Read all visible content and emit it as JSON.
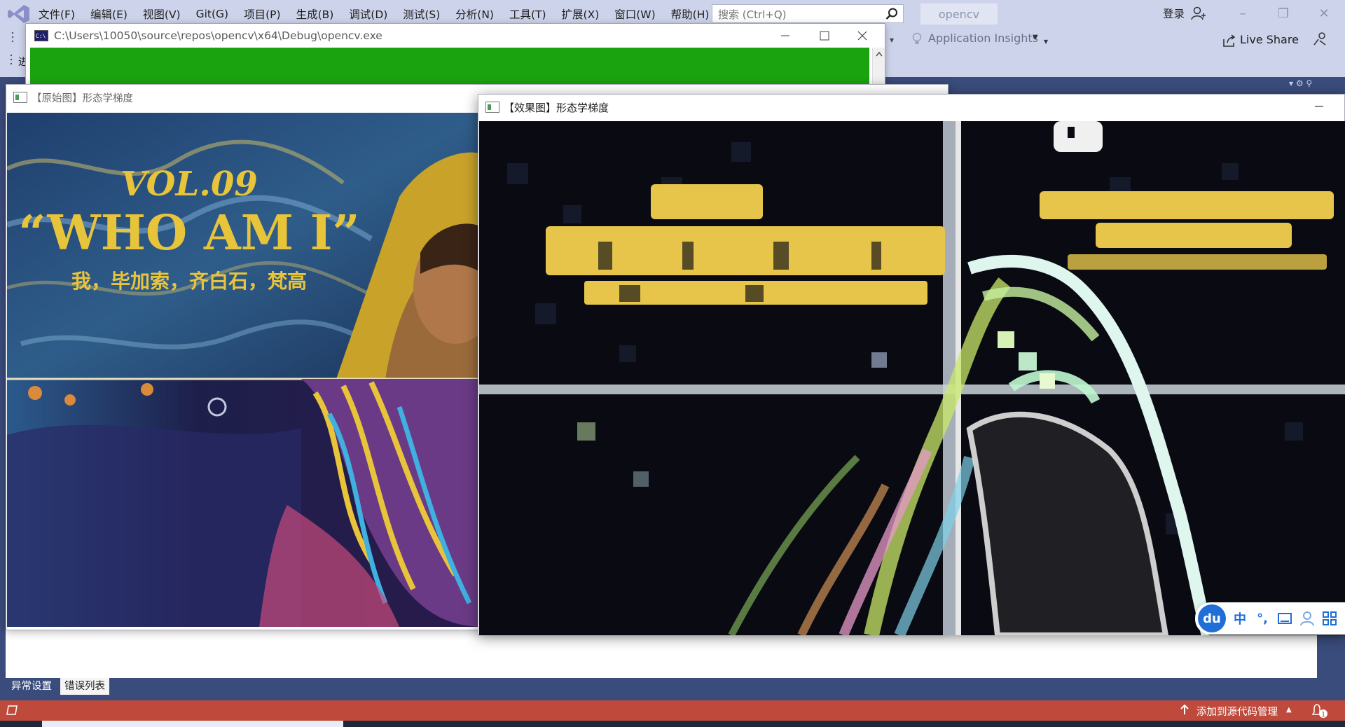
{
  "vs": {
    "menu": [
      "文件(F)",
      "编辑(E)",
      "视图(V)",
      "Git(G)",
      "项目(P)",
      "生成(B)",
      "调试(D)",
      "测试(S)",
      "分析(N)",
      "工具(T)",
      "扩展(X)",
      "窗口(W)",
      "帮助(H)"
    ],
    "search_placeholder": "搜索 (Ctrl+Q)",
    "solution_name": "opencv",
    "login": "登录",
    "app_insights": "Application Insights",
    "live_share": "Live Share",
    "left_text": "进",
    "bottom_tabs": [
      "异常设置",
      "错误列表"
    ],
    "status_source": "添加到源代码管理",
    "notification_count": "1"
  },
  "console": {
    "title": "C:\\Users\\10050\\source\\repos\\opencv\\x64\\Debug\\opencv.exe",
    "icon_label": "C:\\"
  },
  "original_window": {
    "title": "【原始图】形态学梯度",
    "poster": {
      "vol": "VOL.09",
      "headline": "“WHO  AM  I”",
      "subtitle": "我，毕加索，齐白石，梵高"
    }
  },
  "effect_window": {
    "title": "【效果图】形态学梯度"
  },
  "ime": {
    "brand": "du",
    "mode": "中",
    "punct": "°,",
    "items": [
      "keyboard-icon",
      "user-icon",
      "grid-icon"
    ]
  },
  "colors": {
    "vs_frame": "#cdd3ea",
    "vs_dark": "#3a4c7c",
    "status_red": "#bf4a3c",
    "console_green": "#1aa30f",
    "poster_yellow": "#e8c43a",
    "ime_blue": "#1f6fd6"
  }
}
